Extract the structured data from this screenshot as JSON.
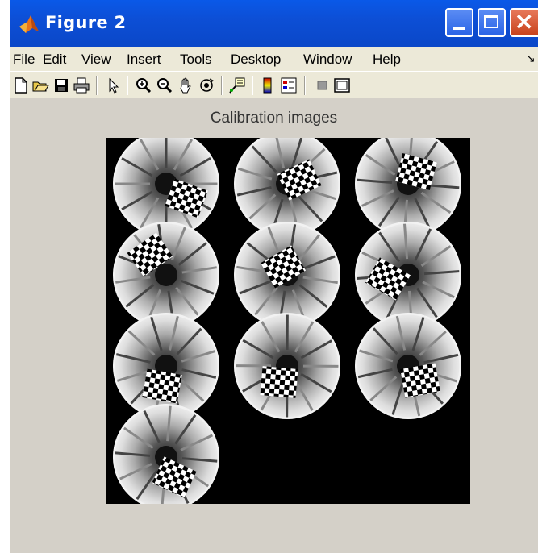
{
  "window": {
    "title": "Figure 2"
  },
  "menu": [
    "File",
    "Edit",
    "View",
    "Insert",
    "Tools",
    "Desktop",
    "Window",
    "Help"
  ],
  "menu_overflow": "↘",
  "toolbar": {
    "tools": [
      "new-figure-icon",
      "open-file-icon",
      "save-icon",
      "print-icon",
      "pointer-icon",
      "zoom-in-icon",
      "zoom-out-icon",
      "pan-hand-icon",
      "rotate-3d-icon",
      "data-cursor-icon",
      "colorbar-icon",
      "legend-icon",
      "hide-plot-tools-icon",
      "show-plot-tools-icon"
    ]
  },
  "figure": {
    "title": "Calibration images",
    "image_count": 10
  },
  "colors": {
    "titlebar": "#0a59e8",
    "close": "#c8421c",
    "background": "#d4d0c8"
  }
}
